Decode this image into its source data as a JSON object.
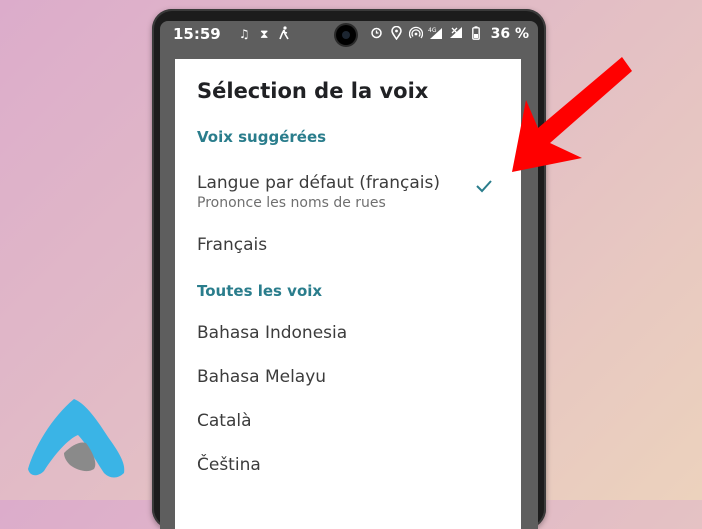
{
  "status_bar": {
    "time": "15:59",
    "left_icons": [
      "music-note-icon",
      "hourglass-icon",
      "walking-icon"
    ],
    "right_icons": [
      "alarm-icon",
      "location-icon",
      "hotspot-icon",
      "signal-4g-icon",
      "signal-icon",
      "battery-icon"
    ],
    "battery_text": "36 %",
    "network_label": "4G"
  },
  "dialog": {
    "title": "Sélection de la voix",
    "sections": [
      {
        "header": "Voix suggérées",
        "options": [
          {
            "label": "Langue par défaut (français)",
            "sublabel": "Prononce les noms de rues",
            "selected": true
          },
          {
            "label": "Français",
            "selected": false
          }
        ]
      },
      {
        "header": "Toutes les voix",
        "options": [
          {
            "label": "Bahasa Indonesia",
            "selected": false
          },
          {
            "label": "Bahasa Melayu",
            "selected": false
          },
          {
            "label": "Català",
            "selected": false
          },
          {
            "label": "Čeština",
            "selected": false
          }
        ]
      }
    ]
  },
  "colors": {
    "accent": "#2a7d8c",
    "arrow": "#ff0000",
    "logo_blue": "#3ab4e6",
    "logo_gray": "#8a8a8a"
  }
}
